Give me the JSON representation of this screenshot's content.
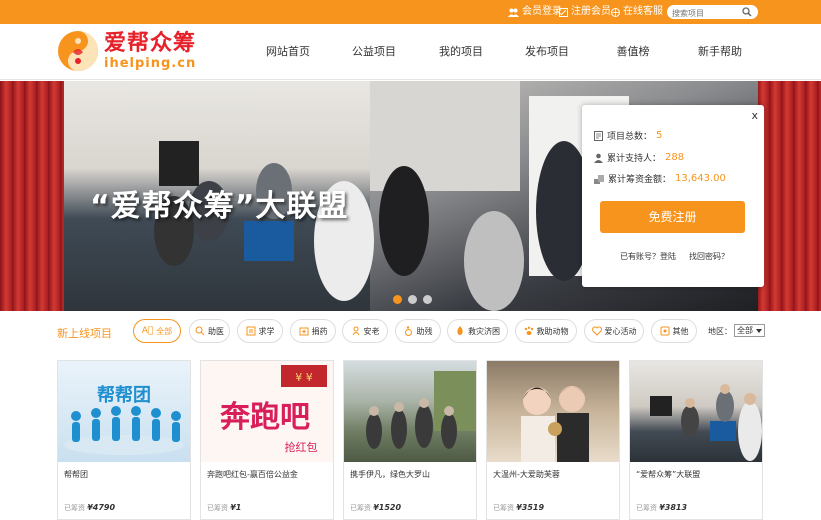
{
  "topbar": {
    "login": "会员登录",
    "register": "注册会员",
    "support": "在线客服",
    "search_placeholder": "搜索项目"
  },
  "logo": {
    "cn": "爱帮众筹",
    "en": "ihelping.cn"
  },
  "nav": [
    "网站首页",
    "公益项目",
    "我的项目",
    "发布项目",
    "善值榜",
    "新手帮助"
  ],
  "banner": {
    "title": "“爱帮众筹”大联盟",
    "slides": 3,
    "active_slide": 1
  },
  "stats": {
    "close": "x",
    "projects_label": "项目总数：",
    "projects_value": "5",
    "supporters_label": "累计支持人：",
    "supporters_value": "288",
    "funds_label": "累计筹资金额：",
    "funds_value": "13,643.00",
    "register_button": "免费注册",
    "have_account": "已有账号？登陆",
    "forgot_password": "找回密码？"
  },
  "categories": {
    "title": "新上线项目",
    "items": [
      {
        "label": "全部",
        "icon": "all-icon"
      },
      {
        "label": "助医",
        "icon": "medical-icon"
      },
      {
        "label": "求学",
        "icon": "study-icon"
      },
      {
        "label": "捐药",
        "icon": "medicine-icon"
      },
      {
        "label": "安老",
        "icon": "elderly-icon"
      },
      {
        "label": "助残",
        "icon": "wheelchair-icon"
      },
      {
        "label": "救灾济困",
        "icon": "fire-icon"
      },
      {
        "label": "救助动物",
        "icon": "paw-icon"
      },
      {
        "label": "爱心活动",
        "icon": "heart-icon"
      },
      {
        "label": "其他",
        "icon": "other-icon"
      }
    ],
    "region_label": "地区：",
    "region_value": "全部"
  },
  "projects": [
    {
      "title": "帮帮团",
      "raised_label": "已筹资",
      "raised": "¥4790"
    },
    {
      "title": "奔跑吧红包-赢百倍公益金",
      "raised_label": "已筹资",
      "raised": "¥1"
    },
    {
      "title": "携手伊凡，绿色大罗山",
      "raised_label": "已筹资",
      "raised": "¥1520"
    },
    {
      "title": "大温州-大爱助芙蓉",
      "raised_label": "已筹资",
      "raised": "¥3519"
    },
    {
      "title": "“爱帮众筹”大联盟",
      "raised_label": "已筹资",
      "raised": "¥3813"
    }
  ],
  "card2_overlay": {
    "headline": "奔跑吧",
    "sub": "抢红包",
    "badge": "¥ ¥"
  },
  "card1_overlay": {
    "headline": "帮帮团"
  },
  "colors": {
    "brand_orange": "#f7941d",
    "brand_red": "#e6212a",
    "banner_red": "#c1272d"
  }
}
